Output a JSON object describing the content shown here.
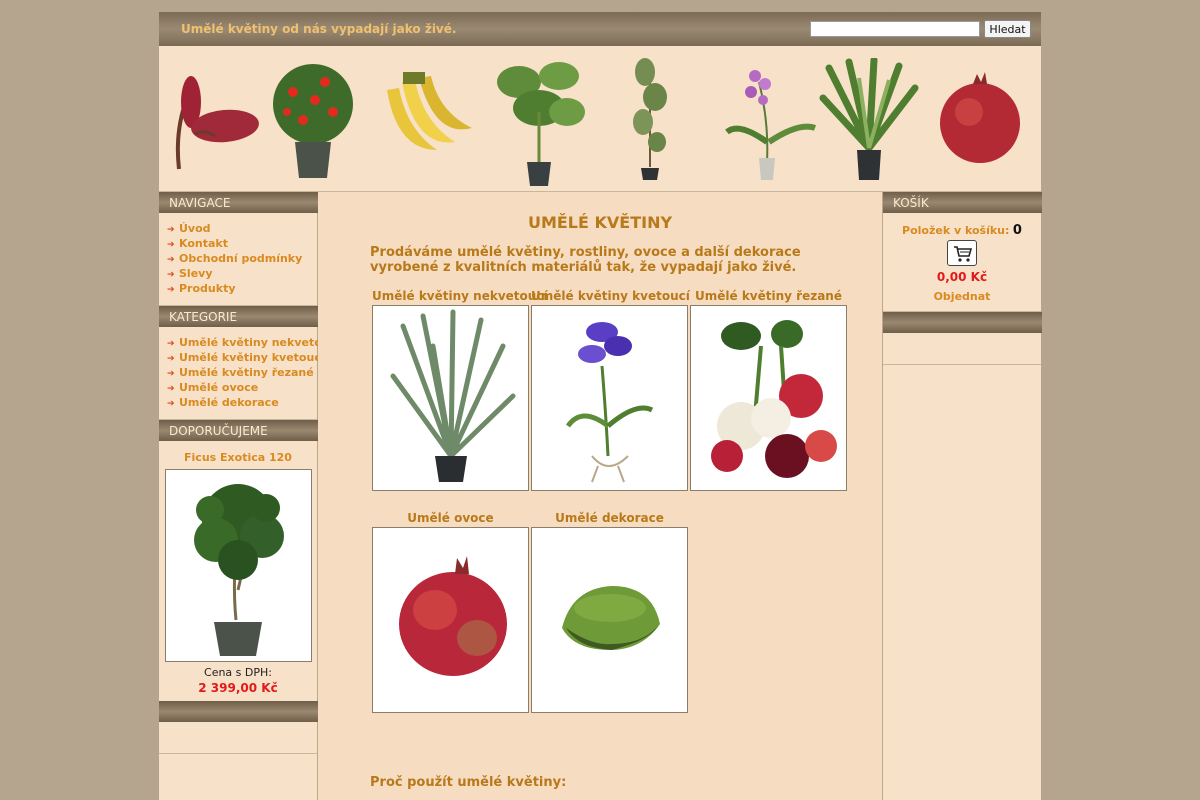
{
  "header": {
    "slogan": "Umělé květiny od nás vypadají jako živé.",
    "search_placeholder": "",
    "search_button": "Hledat"
  },
  "left": {
    "nav_title": "NAVIGACE",
    "nav_items": [
      "Úvod",
      "Kontakt",
      "Obchodní podmínky",
      "Slevy",
      "Produkty"
    ],
    "categories_title": "KATEGORIE",
    "category_items": [
      "Umělé květiny nekvetoucí",
      "Umělé květiny kvetoucí",
      "Umělé květiny řezané",
      "Umělé ovoce",
      "Umělé dekorace"
    ],
    "recommend_title": "DOPORUČUJEME",
    "recommend_name": "Ficus Exotica 120",
    "recommend_price_label": "Cena s DPH:",
    "recommend_price": "2 399,00 Kč"
  },
  "right": {
    "cart_title": "KOŠÍK",
    "cart_count_label": "Položek v košíku:",
    "cart_count": "0",
    "cart_total": "0,00 Kč",
    "cart_order": "Objednat"
  },
  "main": {
    "title": "UMĚLÉ KVĚTINY",
    "intro": "Prodáváme umělé květiny, rostliny, ovoce a další dekorace vyrobené z kvalitních materiálů tak, že vypadají jako živé.",
    "categories": [
      {
        "title": "Umělé květiny nekvetoucí"
      },
      {
        "title": "Umělé květiny kvetoucí"
      },
      {
        "title": "Umělé květiny řezané"
      },
      {
        "title": "Umělé ovoce"
      },
      {
        "title": "Umělé dekorace"
      }
    ],
    "why_title": "Proč použít umělé květiny:"
  },
  "colors": {
    "accent": "#d98a20",
    "heading": "#b8791a",
    "price": "#e21a1a",
    "header_bar": "#8a7962",
    "page_bg": "#f6dcc0"
  }
}
